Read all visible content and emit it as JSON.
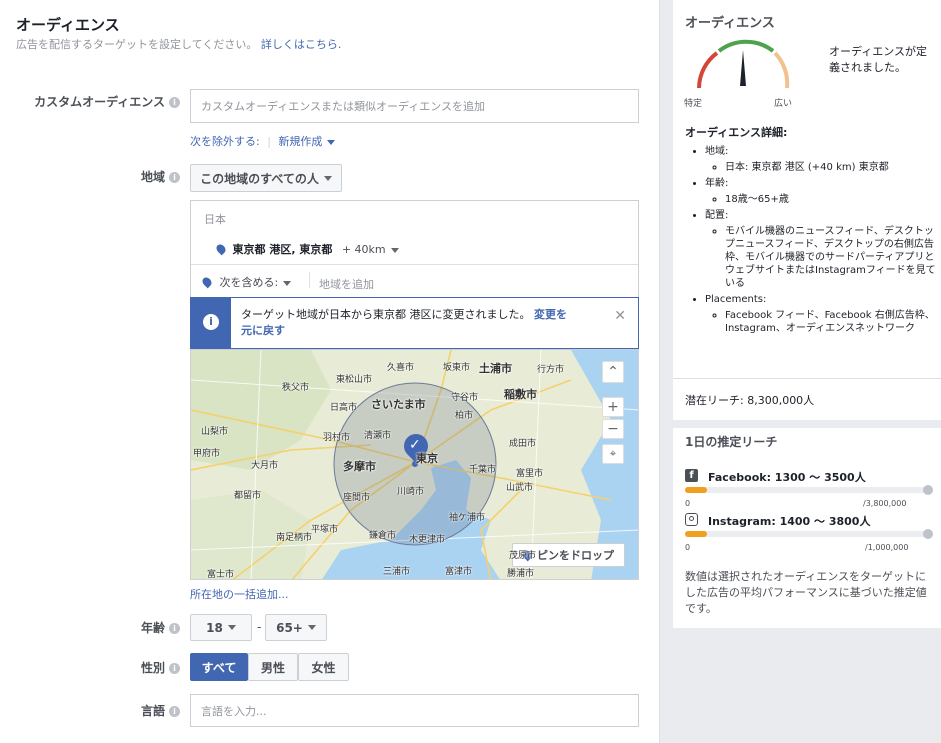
{
  "header": {
    "title": "オーディエンス",
    "subtitle": "広告を配信するターゲットを設定してください。",
    "details_link": "詳しくはこちら."
  },
  "custom_audience": {
    "label": "カスタムオーディエンス",
    "placeholder": "カスタムオーディエンスまたは類似オーディエンスを追加",
    "exclude_link": "次を除外する:",
    "create_new": "新規作成"
  },
  "location": {
    "label": "地域",
    "dropdown": "この地域のすべての人",
    "country": "日本",
    "selected_place": "東京都 港区, 東京都",
    "radius": "+ 40km",
    "include_label": "次を含める:",
    "add_placeholder": "地域を追加",
    "notice": "ターゲット地域が日本から東京都 港区に変更されました。",
    "revert_link_1": "変更を",
    "revert_link_2": "元に戻す",
    "drop_pin": "ピンをドロップ",
    "bulk_add": "所在地の一括追加...",
    "map_labels": [
      "久喜市",
      "坂東市",
      "土浦市",
      "行方市",
      "東松山市",
      "稲敷市",
      "秩父市",
      "さいたま市",
      "守谷市",
      "日高市",
      "柏市",
      "山梨市",
      "清瀬市",
      "羽村市",
      "成田市",
      "甲府市",
      "大月市",
      "多摩市",
      "東京",
      "千葉市",
      "富里市",
      "山武市",
      "都留市",
      "川崎市",
      "座間市",
      "平塚市",
      "袖ケ浦市",
      "南足柄市",
      "鎌倉市",
      "木更津市",
      "茂原市",
      "富士市",
      "三浦市",
      "富津市",
      "勝浦市"
    ]
  },
  "age": {
    "label": "年齢",
    "min": "18",
    "sep": "-",
    "max": "65+"
  },
  "gender": {
    "label": "性別",
    "options": [
      "すべて",
      "男性",
      "女性"
    ],
    "selected": "すべて"
  },
  "language": {
    "label": "言語",
    "placeholder": "言語を入力..."
  },
  "summary": {
    "title": "オーディエンス",
    "gauge_status": "オーディエンスが定義されました。",
    "gauge_left": "特定",
    "gauge_right": "広い",
    "details_title": "オーディエンス詳細:",
    "region_label": "地域:",
    "region_value": "日本: 東京都 港区 (+40 km) 東京都",
    "age_label": "年齢:",
    "age_value": "18歳〜65+歳",
    "placement_label": "配置:",
    "placement_value": "モバイル機器のニュースフィード、デスクトップニュースフィード、デスクトップの右側広告枠、モバイル機器でのサードパーティアプリとウェブサイトまたはInstagramフィードを見ている",
    "placements_label": "Placements:",
    "placements_value": "Facebook フィード、Facebook 右側広告枠、Instagram、オーディエンスネットワーク",
    "potential_reach": "潜在リーチ: 8,300,000人"
  },
  "daily_reach": {
    "title": "1日の推定リーチ",
    "facebook": {
      "label": "Facebook: 1300 〜 3500人",
      "min": "0",
      "max": "/3,800,000",
      "fill": 0.09
    },
    "instagram": {
      "label": "Instagram: 1400 〜 3800人",
      "min": "0",
      "max": "/1,000,000",
      "fill": 0.09
    },
    "note": "数値は選択されたオーディエンスをターゲットにした広告の平均パフォーマンスに基づいた推定値です。"
  },
  "colors": {
    "accent": "#4267b2",
    "gauge_red": "#d4463b",
    "gauge_green": "#4ea24e",
    "gauge_orange": "#f2c18e",
    "bar_fill": "#f0a01c"
  }
}
